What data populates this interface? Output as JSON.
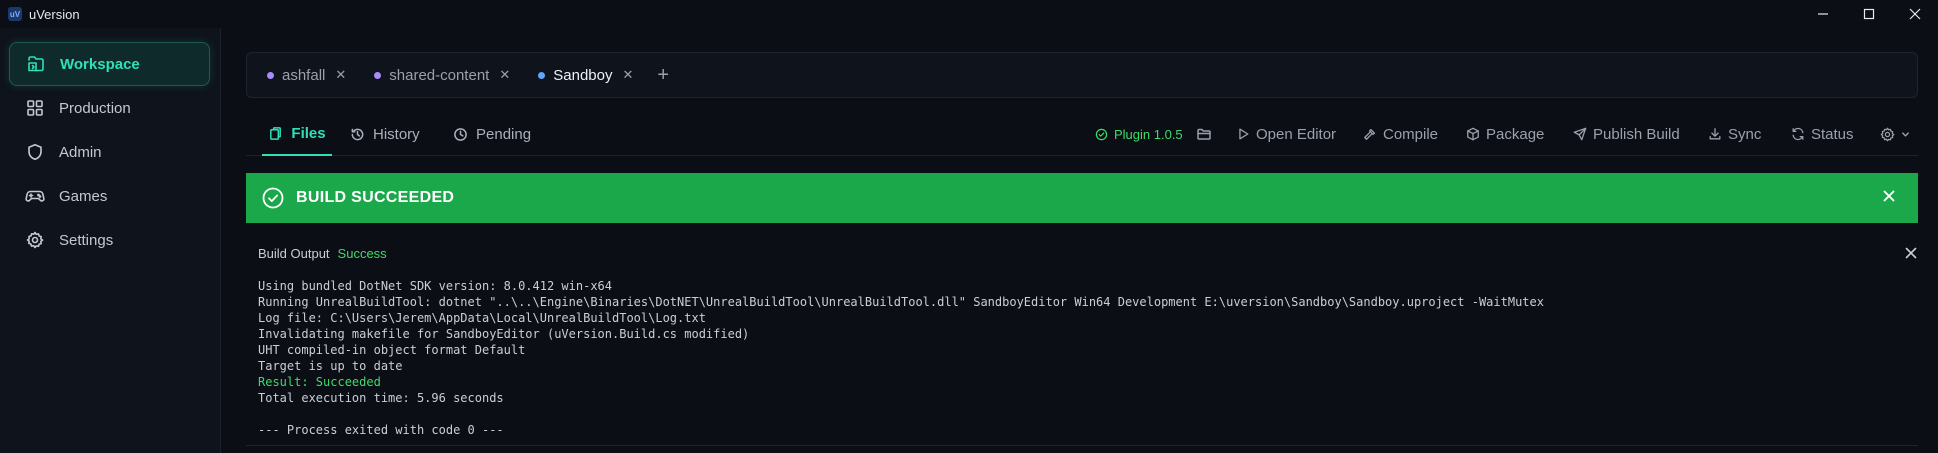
{
  "window": {
    "logo_text": "uV",
    "title": "uVersion"
  },
  "sidebar": {
    "items": [
      {
        "label": "Workspace",
        "icon": "workspace-icon",
        "active": true
      },
      {
        "label": "Production",
        "icon": "grid-icon",
        "active": false
      },
      {
        "label": "Admin",
        "icon": "shield-icon",
        "active": false
      },
      {
        "label": "Games",
        "icon": "gamepad-icon",
        "active": false
      },
      {
        "label": "Settings",
        "icon": "gear-icon",
        "active": false
      }
    ]
  },
  "workspace_tabs": [
    {
      "label": "ashfall",
      "dot_color": "#a78bfa",
      "active": false
    },
    {
      "label": "shared-content",
      "dot_color": "#a78bfa",
      "active": false
    },
    {
      "label": "Sandboy",
      "dot_color": "#60a5fa",
      "active": true
    }
  ],
  "workspace_tab_close": "✕",
  "workspace_tab_add": "+",
  "sub_tabs": {
    "files": "Files",
    "history": "History",
    "pending": "Pending"
  },
  "toolbar": {
    "plugin": "Plugin 1.0.5",
    "open_editor": "Open Editor",
    "compile": "Compile",
    "package": "Package",
    "publish_build": "Publish Build",
    "sync": "Sync",
    "status": "Status"
  },
  "banner": {
    "text": "BUILD SUCCEEDED",
    "color": "#1ba84b"
  },
  "output": {
    "label": "Build Output",
    "status": "Success",
    "lines": [
      {
        "text": "Using bundled DotNet SDK version: 8.0.412 win-x64",
        "kind": "normal"
      },
      {
        "text": "Running UnrealBuildTool: dotnet \"..\\..\\Engine\\Binaries\\DotNET\\UnrealBuildTool\\UnrealBuildTool.dll\" SandboyEditor Win64 Development E:\\uversion\\Sandboy\\Sandboy.uproject -WaitMutex",
        "kind": "normal"
      },
      {
        "text": "Log file: C:\\Users\\Jerem\\AppData\\Local\\UnrealBuildTool\\Log.txt",
        "kind": "normal"
      },
      {
        "text": "Invalidating makefile for SandboyEditor (uVersion.Build.cs modified)",
        "kind": "normal"
      },
      {
        "text": "UHT compiled-in object format Default",
        "kind": "normal"
      },
      {
        "text": "Target is up to date",
        "kind": "normal"
      },
      {
        "text": "Result: Succeeded",
        "kind": "ok"
      },
      {
        "text": "Total execution time: 5.96 seconds",
        "kind": "normal"
      },
      {
        "text": "",
        "kind": "blank"
      },
      {
        "text": "--- Process exited with code 0 ---",
        "kind": "normal"
      }
    ]
  },
  "colors": {
    "accent": "#2fe0b8",
    "success": "#3ddc6a",
    "background": "#0b0e15"
  }
}
